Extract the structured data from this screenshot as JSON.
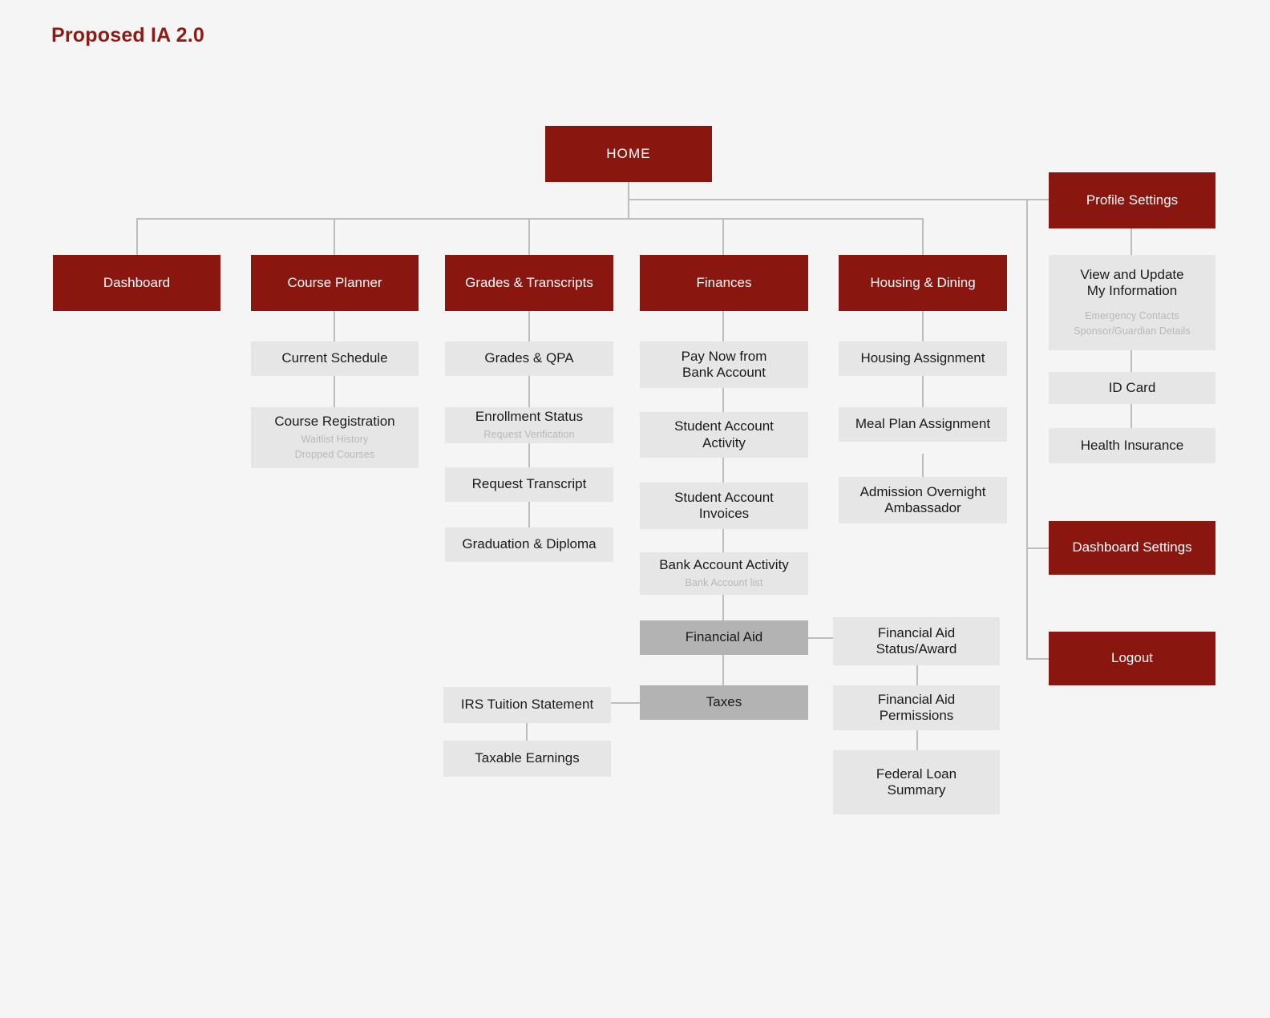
{
  "title": "Proposed IA 2.0",
  "colors": {
    "background": "#f5f5f5",
    "primary_red": "#8a1610",
    "title_red": "#8e1b14",
    "node_light_gray": "#e6e6e6",
    "node_mid_gray": "#b3b3b3",
    "connector_gray": "#bdbdbd",
    "sub_text_gray": "#b8b8b8"
  },
  "root": {
    "label": "HOME"
  },
  "columns": {
    "dashboard": {
      "label": "Dashboard"
    },
    "course_planner": {
      "label": "Course Planner",
      "children": [
        {
          "label": "Current Schedule"
        },
        {
          "label": "Course Registration",
          "sub": [
            "Waitlist History",
            "Dropped Courses"
          ]
        }
      ]
    },
    "grades_transcripts": {
      "label": "Grades & Transcripts",
      "children": [
        {
          "label": "Grades & QPA"
        },
        {
          "label": "Enrollment Status",
          "sub": [
            "Request Verification"
          ]
        },
        {
          "label": "Request Transcript"
        },
        {
          "label": "Graduation & Diploma"
        }
      ]
    },
    "finances": {
      "label": "Finances",
      "children": [
        {
          "label": "Pay Now from\nBank Account"
        },
        {
          "label": "Student Account\nActivity"
        },
        {
          "label": "Student Account\nInvoices"
        },
        {
          "label": "Bank Account Activity",
          "sub": [
            "Bank Account list"
          ]
        },
        {
          "label": "Financial Aid"
        },
        {
          "label": "Taxes"
        }
      ]
    },
    "housing_dining": {
      "label": "Housing & Dining",
      "children": [
        {
          "label": "Housing Assignment"
        },
        {
          "label": "Meal Plan Assignment"
        },
        {
          "label": "Admission Overnight\nAmbassador"
        }
      ]
    }
  },
  "financial_aid_branch": [
    {
      "label": "Financial Aid\nStatus/Award"
    },
    {
      "label": "Financial Aid\nPermissions"
    },
    {
      "label": "Federal Loan\nSummary"
    }
  ],
  "taxes_branch": [
    {
      "label": "IRS Tuition Statement"
    },
    {
      "label": "Taxable Earnings"
    }
  ],
  "sidebar": {
    "profile_settings": {
      "label": "Profile Settings"
    },
    "profile_children": [
      {
        "label": "View and Update\nMy Information",
        "sub": [
          "Emergency Contacts",
          "Sponsor/Guardian Details"
        ]
      },
      {
        "label": "ID Card"
      },
      {
        "label": "Health Insurance"
      }
    ],
    "dashboard_settings": {
      "label": "Dashboard Settings"
    },
    "logout": {
      "label": "Logout"
    }
  }
}
